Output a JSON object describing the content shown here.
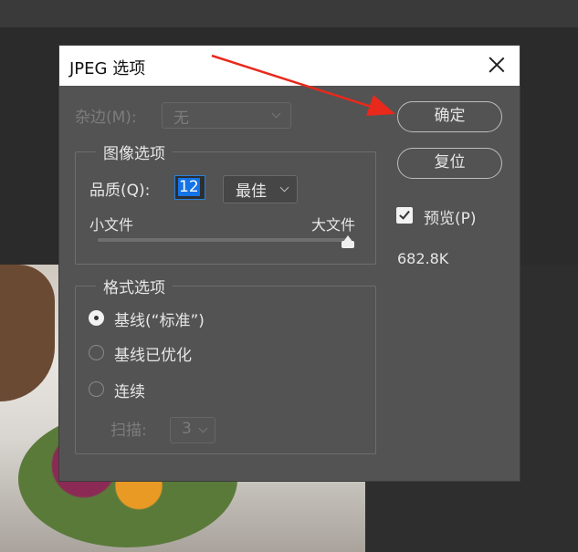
{
  "dialog": {
    "title": "JPEG 选项",
    "matte": {
      "label": "杂边(M):",
      "value": "无"
    },
    "image_options": {
      "group_title": "图像选项",
      "quality_label": "品质(Q):",
      "quality_value": "12",
      "quality_preset": "最佳",
      "small_file": "小文件",
      "large_file": "大文件",
      "slider_fraction": 1.0
    },
    "format_options": {
      "group_title": "格式选项",
      "baseline_standard": "基线(“标准”)",
      "baseline_optimized": "基线已优化",
      "progressive": "连续",
      "scans_label": "扫描:",
      "scans_value": "3"
    },
    "ok_label": "确定",
    "reset_label": "复位",
    "preview_label": "预览(P)",
    "preview_checked": true,
    "file_size": "682.8K"
  },
  "colors": {
    "dialog_bg": "#535353",
    "annotation_arrow": "#e8291c",
    "selection": "#1473e6"
  }
}
